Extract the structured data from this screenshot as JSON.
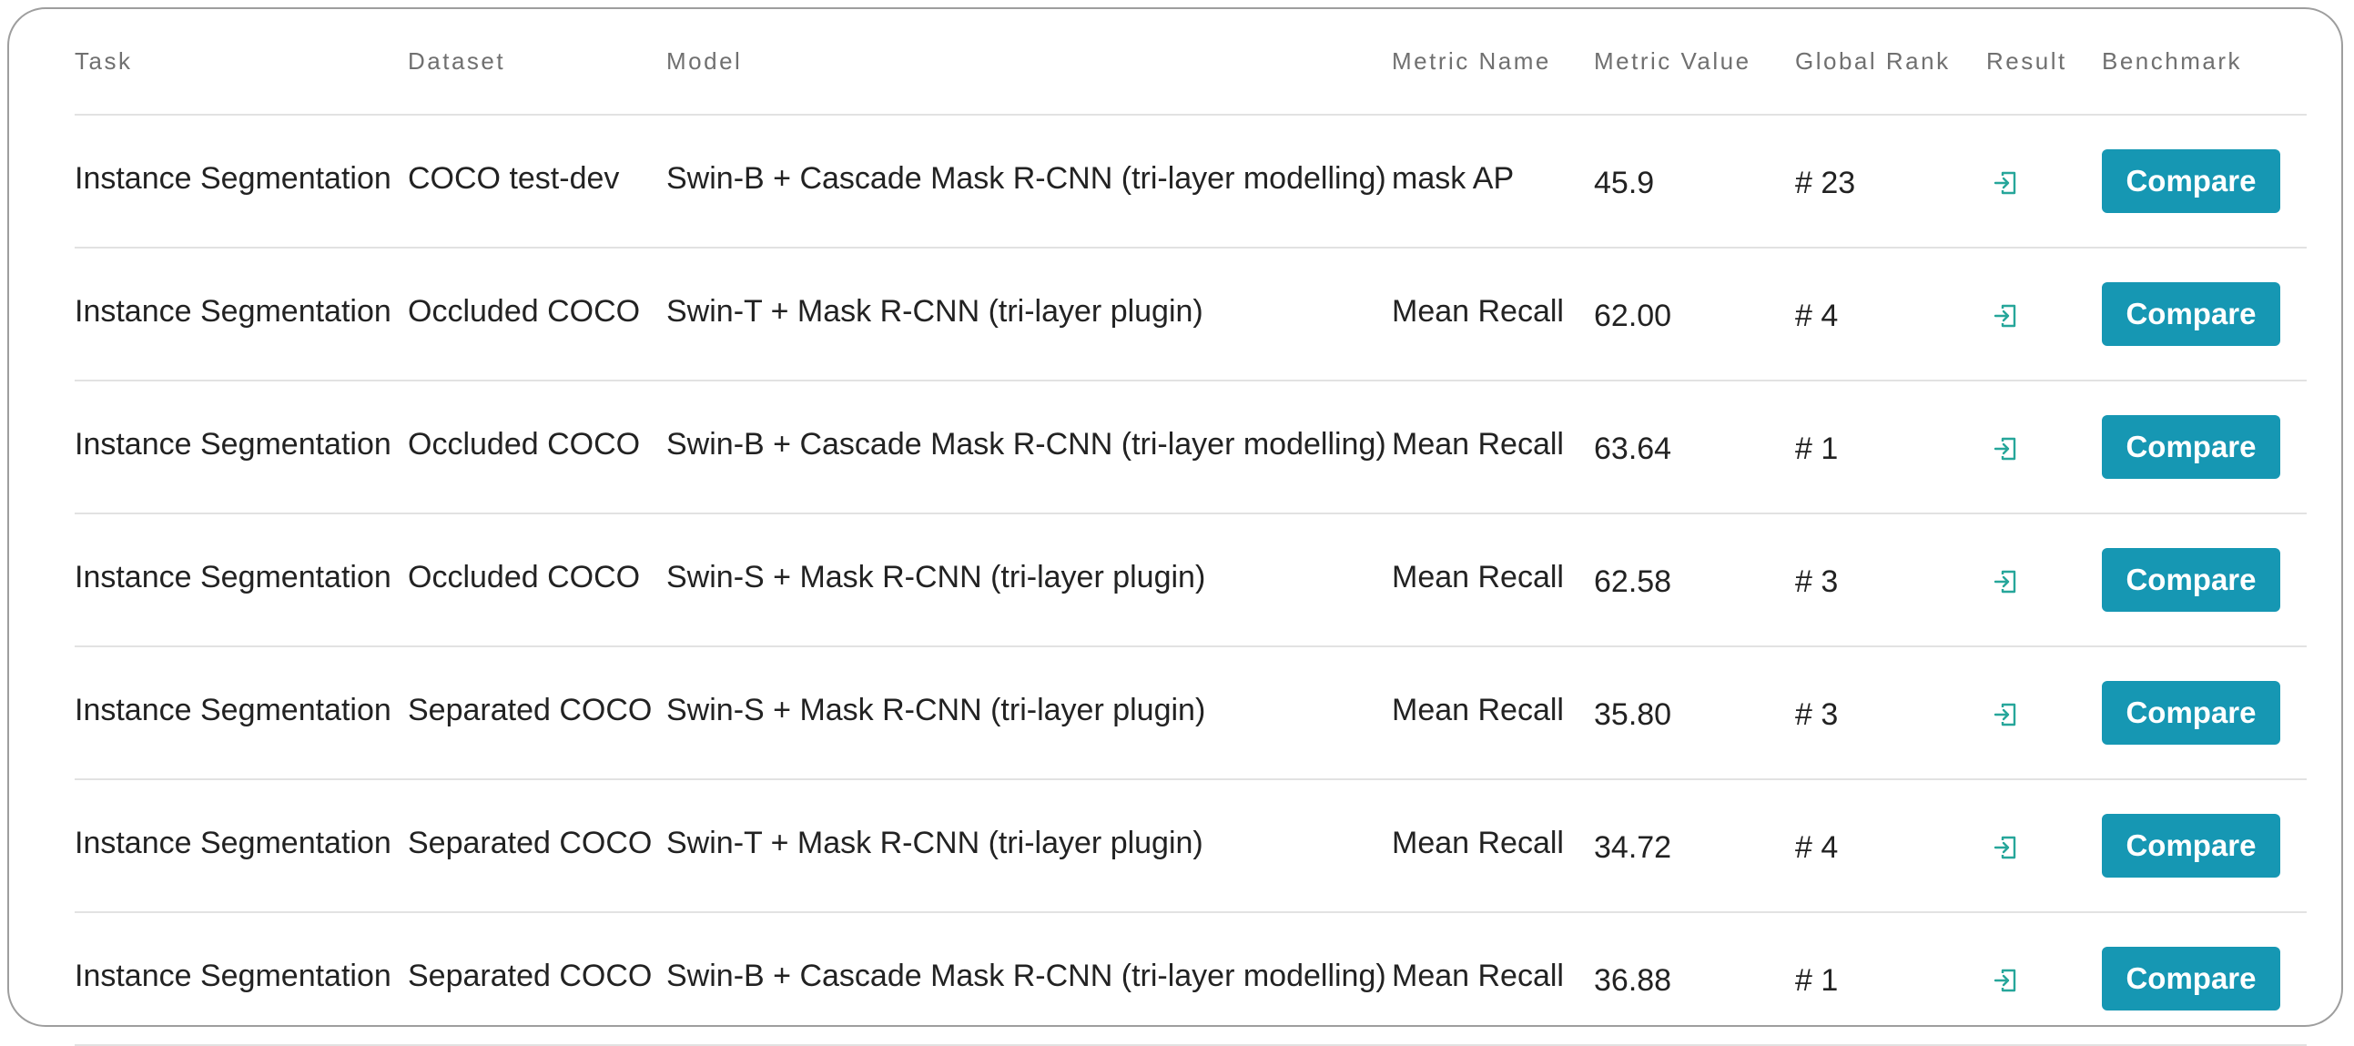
{
  "columns": {
    "task": "Task",
    "dataset": "Dataset",
    "model": "Model",
    "metric_name": "Metric Name",
    "metric_value": "Metric Value",
    "global_rank": "Global Rank",
    "result": "Result",
    "benchmark": "Benchmark"
  },
  "rows": [
    {
      "task": "Instance Segmentation",
      "dataset": "COCO test-dev",
      "model": "Swin-B + Cascade Mask R-CNN (tri-layer modelling)",
      "metric_name": "mask AP",
      "metric_value": "45.9",
      "global_rank": "# 23",
      "result_icon": "external-link-icon",
      "benchmark_label": "Compare"
    },
    {
      "task": "Instance Segmentation",
      "dataset": "Occluded COCO",
      "model": "Swin-T + Mask R-CNN (tri-layer plugin)",
      "metric_name": "Mean Recall",
      "metric_value": "62.00",
      "global_rank": "# 4",
      "result_icon": "external-link-icon",
      "benchmark_label": "Compare"
    },
    {
      "task": "Instance Segmentation",
      "dataset": "Occluded COCO",
      "model": "Swin-B + Cascade Mask R-CNN (tri-layer modelling)",
      "metric_name": "Mean Recall",
      "metric_value": "63.64",
      "global_rank": "# 1",
      "result_icon": "external-link-icon",
      "benchmark_label": "Compare"
    },
    {
      "task": "Instance Segmentation",
      "dataset": "Occluded COCO",
      "model": "Swin-S + Mask R-CNN (tri-layer plugin)",
      "metric_name": "Mean Recall",
      "metric_value": "62.58",
      "global_rank": "# 3",
      "result_icon": "external-link-icon",
      "benchmark_label": "Compare"
    },
    {
      "task": "Instance Segmentation",
      "dataset": "Separated COCO",
      "model": "Swin-S + Mask R-CNN (tri-layer plugin)",
      "metric_name": "Mean Recall",
      "metric_value": "35.80",
      "global_rank": "# 3",
      "result_icon": "external-link-icon",
      "benchmark_label": "Compare"
    },
    {
      "task": "Instance Segmentation",
      "dataset": "Separated COCO",
      "model": "Swin-T + Mask R-CNN (tri-layer plugin)",
      "metric_name": "Mean Recall",
      "metric_value": "34.72",
      "global_rank": "# 4",
      "result_icon": "external-link-icon",
      "benchmark_label": "Compare"
    },
    {
      "task": "Instance Segmentation",
      "dataset": "Separated COCO",
      "model": "Swin-B + Cascade Mask R-CNN (tri-layer modelling)",
      "metric_name": "Mean Recall",
      "metric_value": "36.88",
      "global_rank": "# 1",
      "result_icon": "external-link-icon",
      "benchmark_label": "Compare"
    }
  ],
  "colors": {
    "accent": "#1697b3",
    "result_icon": "#26a69a",
    "border": "#9e9e9e",
    "divider": "#e2e2e2",
    "header_text": "#707070"
  }
}
